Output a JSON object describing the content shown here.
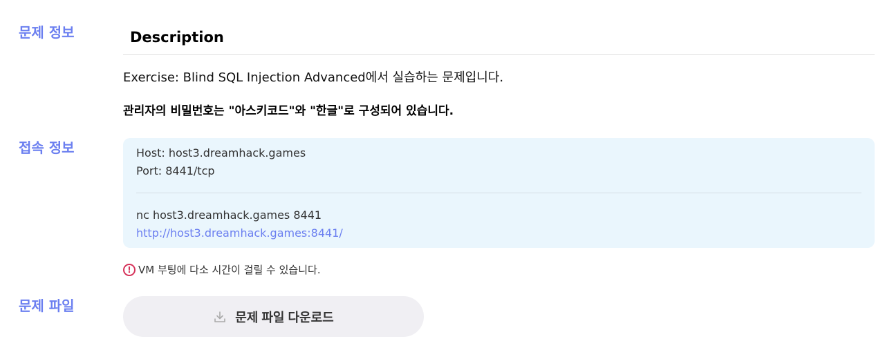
{
  "sections": {
    "problem_info": "문제 정보",
    "connection_info": "접속 정보",
    "problem_file": "문제 파일"
  },
  "description": {
    "title": "Description",
    "line1": "Exercise: Blind SQL Injection Advanced에서 실습하는 문제입니다.",
    "line2": "관리자의 비밀번호는 \"아스키코드\"와 \"한글\"로 구성되어 있습니다."
  },
  "connection": {
    "host": "Host: host3.dreamhack.games",
    "port": "Port: 8441/tcp",
    "nc_command": "nc host3.dreamhack.games 8441",
    "url": "http://host3.dreamhack.games:8441/"
  },
  "notice": {
    "icon": "exclamation-circle-icon",
    "text": "VM 부팅에 다소 시간이 걸릴 수 있습니다."
  },
  "download": {
    "icon": "download-icon",
    "label": "문제 파일 다운로드"
  },
  "colors": {
    "accent": "#6b7ff0",
    "box_bg": "#eaf6fd",
    "warning": "#d6335a",
    "button_bg": "#f0eff3"
  }
}
